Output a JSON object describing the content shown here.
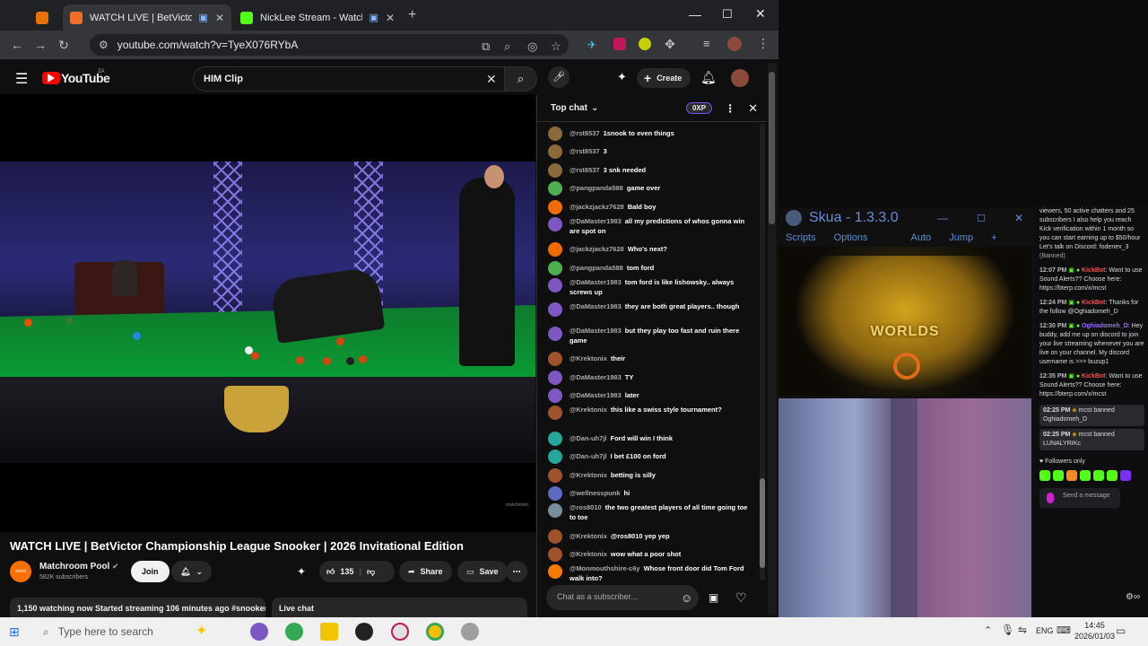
{
  "browser": {
    "tabs": [
      {
        "title": "WATCH LIVE | BetVictor Cha",
        "active": true
      },
      {
        "title": "NickLee Stream - Watch Liv",
        "active": false
      }
    ],
    "url": "youtube.com/watch?v=TyeX076RYbA"
  },
  "youtube": {
    "logo_text": "YouTube",
    "logo_badge": "ZA",
    "search_value": "HIM Clip",
    "create_label": "Create",
    "video_watermark": "matchroom",
    "title": "WATCH LIVE | BetVictor Championship League Snooker | 2026 Invitational Edition",
    "channel": "Matchroom Pool",
    "subscribers": "582K subscribers",
    "join_label": "Join",
    "likes": "135",
    "share_label": "Share",
    "save_label": "Save",
    "desc_line": "1,150 watching now  Started streaming 106 minutes ago  #snooker",
    "live_chat_label": "Live chat",
    "channel_avatar_text": "world"
  },
  "chat": {
    "header": "Top chat",
    "xp_badge": "0XP",
    "input_placeholder": "Chat as a subscriber...",
    "messages": [
      {
        "author": "@rst8537",
        "text": "1snook to even things",
        "color": "#8a6a3a"
      },
      {
        "author": "@rst8537",
        "text": "3",
        "color": "#8a6a3a"
      },
      {
        "author": "@rst8537",
        "text": "3 snk needed",
        "color": "#8a6a3a"
      },
      {
        "author": "@pangpanda588",
        "text": "game over",
        "color": "#4caf50"
      },
      {
        "author": "@jackzjackz7628",
        "text": "Bald boy",
        "color": "#ef6c00"
      },
      {
        "author": "@DaMaster1983",
        "text": "all my predictions of whos gonna win are spot on",
        "color": "#7e57c2"
      },
      {
        "author": "@jackzjackz7628",
        "text": "Who's next?",
        "color": "#ef6c00"
      },
      {
        "author": "@pangpanda588",
        "text": "tom ford",
        "color": "#4caf50"
      },
      {
        "author": "@DaMaster1983",
        "text": "tom ford is like lishowsky.. always screws up",
        "color": "#7e57c2"
      },
      {
        "author": "@DaMaster1983",
        "text": "they are both great players.. though",
        "color": "#7e57c2"
      },
      {
        "author": "@DaMaster1983",
        "text": "but they play too fast and ruin there game",
        "color": "#7e57c2"
      },
      {
        "author": "@Krektonix",
        "text": "their",
        "color": "#a0522d"
      },
      {
        "author": "@DaMaster1983",
        "text": "TY",
        "color": "#7e57c2"
      },
      {
        "author": "@DaMaster1983",
        "text": "later",
        "color": "#7e57c2"
      },
      {
        "author": "@Krektonix",
        "text": "this like a swiss style tournament?",
        "color": "#a0522d"
      },
      {
        "author": "@Dan-uh7jl",
        "text": "Ford will win I think",
        "color": "#26a69a"
      },
      {
        "author": "@Dan-uh7jl",
        "text": "I bet £100 on ford",
        "color": "#26a69a"
      },
      {
        "author": "@Krektonix",
        "text": "betting is silly",
        "color": "#a0522d"
      },
      {
        "author": "@wellnesspunk",
        "text": "hi",
        "color": "#5c6bc0"
      },
      {
        "author": "@ros8010",
        "text": "the two greatest players of all time going toe to toe",
        "color": "#78909c"
      },
      {
        "author": "@Krektonix",
        "text": "@ros8010 yep yep",
        "color": "#a0522d"
      },
      {
        "author": "@Krektonix",
        "text": "wow what a poor shot",
        "color": "#a0522d"
      },
      {
        "author": "@Monmouthshire-c6y",
        "text": "Whose front door did Tom Ford walk into?",
        "color": "#f57c00"
      }
    ]
  },
  "skua": {
    "title": "Skua - 1.3.3.0",
    "menu": [
      "Scripts",
      "Options",
      "Auto",
      "Jump",
      "+"
    ],
    "game_logo": "WORLDS"
  },
  "kick": {
    "top_text": "viewers, 50 active chatters and 25 subscribers I also help you reach Kick verification within 1 month so you can start earning up to $50/hour Let's talk on Discord: fodenex_3",
    "banned_tag": "(Banned)",
    "messages": [
      {
        "time": "12:07 PM",
        "user": "KickBot",
        "text": "Want to use Sound Alerts?? Choose here: https://bterp.com/x/mcst"
      },
      {
        "time": "12:24 PM",
        "user": "KickBot",
        "text": "Thanks for the follow @Oghiadomeh_D"
      },
      {
        "time": "12:30 PM",
        "user": "Oghiadomeh_D",
        "text": "Hey buddy, add me up on discord to join your live streaming whenever you are live on your channel. My discord username is >>> buzup1"
      },
      {
        "time": "12:35 PM",
        "user": "KickBot",
        "text": "Want to use Sound Alerts?? Choose here: https://bterp.com/x/mcst"
      }
    ],
    "mod_events": [
      {
        "time": "02:25 PM",
        "text": "mcst banned",
        "target": "Oghiadomeh_D"
      },
      {
        "time": "02:25 PM",
        "text": "mcst banned",
        "target": "LUNALYRIKc"
      }
    ],
    "followers_only": "Followers only",
    "send_placeholder": "Send a message"
  },
  "taskbar": {
    "search_placeholder": "Type here to search",
    "lang": "ENG",
    "time": "14:45",
    "date": "2026/01/03"
  }
}
